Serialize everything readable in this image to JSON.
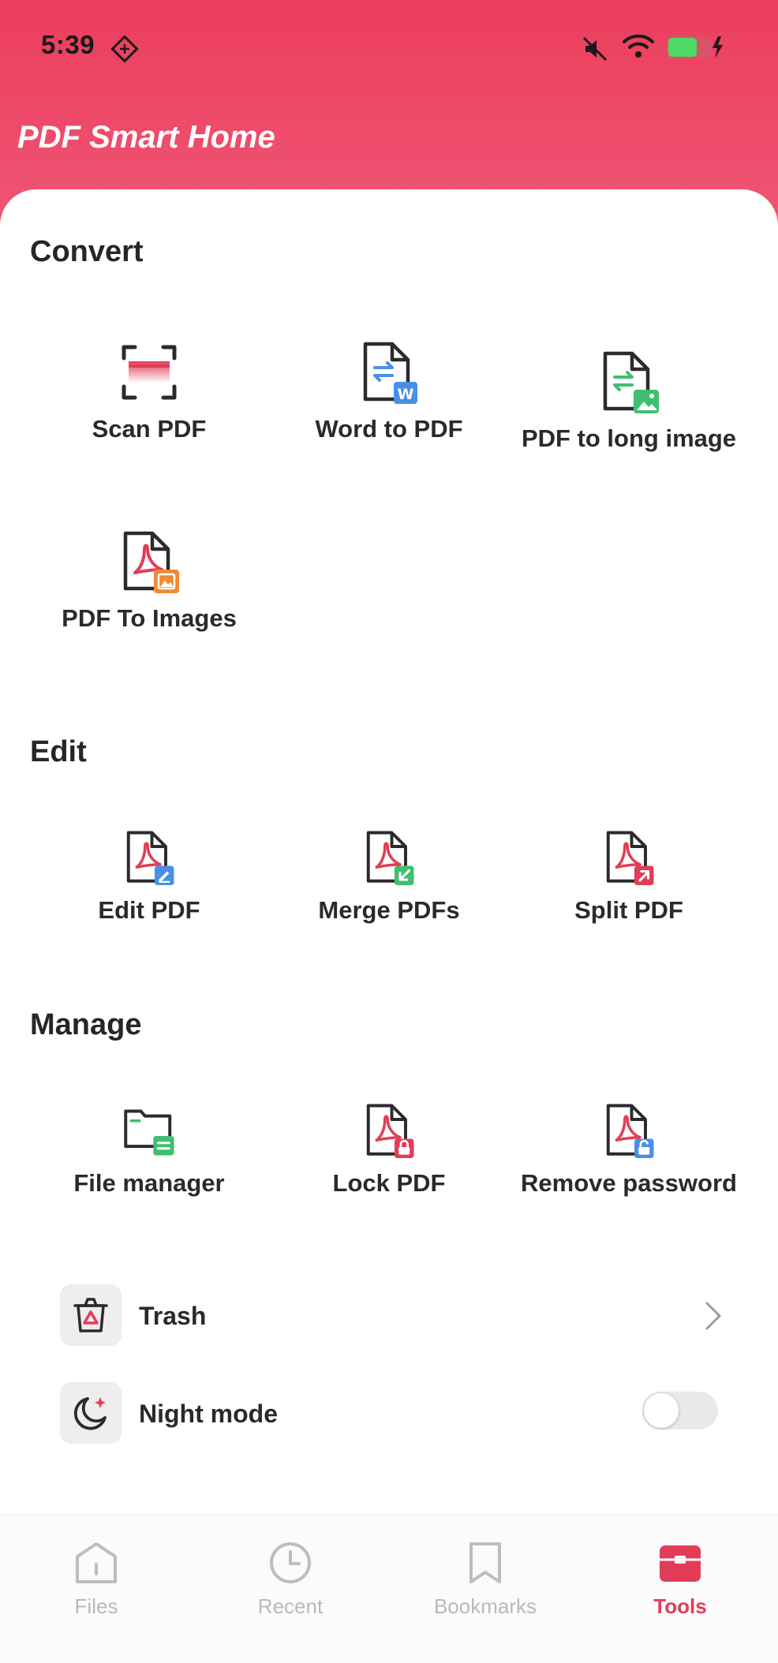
{
  "status": {
    "time": "5:39"
  },
  "app": {
    "title": "PDF Smart Home"
  },
  "sections": {
    "convert": {
      "title": "Convert",
      "items": [
        "Scan PDF",
        "Word to PDF",
        "PDF to long image",
        "PDF To Images"
      ]
    },
    "edit": {
      "title": "Edit",
      "items": [
        "Edit PDF",
        "Merge PDFs",
        "Split PDF"
      ]
    },
    "manage": {
      "title": "Manage",
      "items": [
        "File manager",
        "Lock PDF",
        "Remove password"
      ]
    }
  },
  "settings": {
    "trash": "Trash",
    "night_mode": "Night mode",
    "night_mode_on": false
  },
  "tabs": [
    "Files",
    "Recent",
    "Bookmarks",
    "Tools"
  ],
  "active_tab": "Tools",
  "colors": {
    "brand": "#e23d58",
    "header": "#ec3d5c",
    "word": "#4a8fe7",
    "image": "#3fbf6f",
    "orange": "#f08a35"
  },
  "icons": {
    "scan": "scan-icon",
    "word_to_pdf": "word-to-pdf-icon",
    "pdf_to_long_image": "pdf-to-long-image-icon",
    "pdf_to_images": "pdf-to-images-icon",
    "edit_pdf": "edit-pdf-icon",
    "merge_pdfs": "merge-pdfs-icon",
    "split_pdf": "split-pdf-icon",
    "file_manager": "folder-icon",
    "lock_pdf": "lock-pdf-icon",
    "remove_password": "unlock-pdf-icon",
    "trash": "trash-icon",
    "night_mode": "moon-icon"
  }
}
